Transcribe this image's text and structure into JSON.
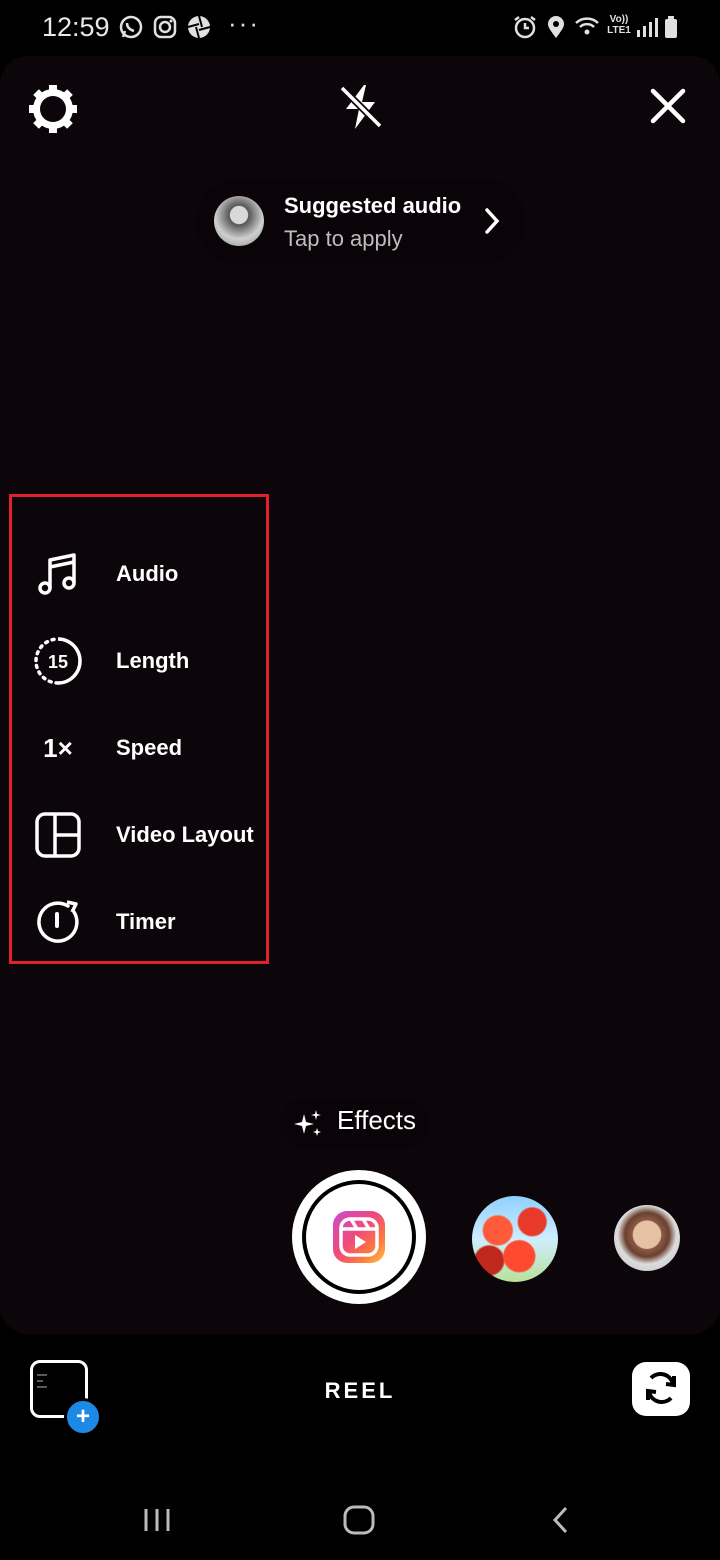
{
  "status_bar": {
    "time": "12:59",
    "more": "···",
    "network": "Vo)) LTE1",
    "left_icons": [
      "whatsapp-icon",
      "instagram-icon",
      "aperture-icon"
    ],
    "right_icons": [
      "alarm-icon",
      "location-icon",
      "wifi-icon",
      "signal-icon",
      "battery-icon"
    ]
  },
  "top_controls": {
    "settings_icon": "gear-icon",
    "flash_icon": "flash-off-icon",
    "close_icon": "close-icon"
  },
  "suggested_audio": {
    "title": "Suggested audio",
    "subtitle": "Tap to apply"
  },
  "tools_menu": {
    "items": [
      {
        "label": "Audio",
        "icon": "music-note-icon"
      },
      {
        "label": "Length",
        "icon": "length-timer-icon",
        "icon_text": "15"
      },
      {
        "label": "Speed",
        "icon": "speed-icon",
        "icon_text": "1×"
      },
      {
        "label": "Video Layout",
        "icon": "layout-icon"
      },
      {
        "label": "Timer",
        "icon": "timer-icon"
      }
    ],
    "highlight_color": "#e0202a"
  },
  "effects": {
    "label": "Effects",
    "icon": "sparkles-icon"
  },
  "capture": {
    "icon": "reels-icon"
  },
  "bottom_bar": {
    "mode": "REEL",
    "gallery_plus": "+",
    "flip_icon": "flip-camera-icon"
  },
  "colors": {
    "accent_blue": "#1e88e5",
    "viewport_bg": "#0c050a"
  }
}
